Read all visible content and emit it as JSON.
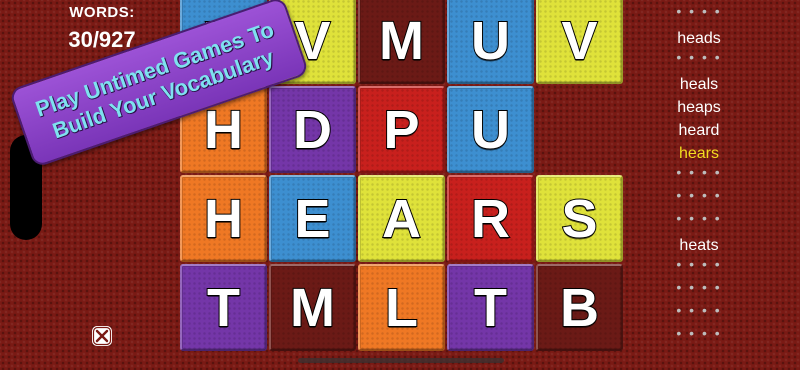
{
  "score": {
    "label": "WORDS:",
    "value": "30/927"
  },
  "board": {
    "tiles": [
      {
        "letter": "V",
        "color": "#3d8fd0"
      },
      {
        "letter": "V",
        "color": "#dfe23a"
      },
      {
        "letter": "M",
        "color": "#6b1a16"
      },
      {
        "letter": "U",
        "color": "#3d8fd0"
      },
      {
        "letter": "V",
        "color": "#dfe23a"
      },
      {
        "letter": "H",
        "color": "#ef7824"
      },
      {
        "letter": "D",
        "color": "#7436a8"
      },
      {
        "letter": "P",
        "color": "#c8201d"
      },
      {
        "letter": "U",
        "color": "#3d8fd0"
      },
      null,
      {
        "letter": "H",
        "color": "#ef7824"
      },
      {
        "letter": "E",
        "color": "#3d8fd0"
      },
      {
        "letter": "A",
        "color": "#dfe23a"
      },
      {
        "letter": "R",
        "color": "#c8201d"
      },
      {
        "letter": "S",
        "color": "#dfe23a"
      },
      {
        "letter": "T",
        "color": "#7436a8"
      },
      {
        "letter": "M",
        "color": "#6b1a16"
      },
      {
        "letter": "L",
        "color": "#ef7824"
      },
      {
        "letter": "T",
        "color": "#7436a8"
      },
      {
        "letter": "B",
        "color": "#6b1a16"
      }
    ]
  },
  "word_list": [
    {
      "text": "• • • •",
      "state": "hidden"
    },
    {
      "text": "heads",
      "state": "found"
    },
    {
      "text": "• • • •",
      "state": "hidden"
    },
    {
      "text": "heals",
      "state": "found"
    },
    {
      "text": "heaps",
      "state": "found"
    },
    {
      "text": "heard",
      "state": "found"
    },
    {
      "text": "hears",
      "state": "highlight"
    },
    {
      "text": "• • • •",
      "state": "hidden"
    },
    {
      "text": "• • • •",
      "state": "hidden"
    },
    {
      "text": "• • • •",
      "state": "hidden"
    },
    {
      "text": "heats",
      "state": "found"
    },
    {
      "text": "• • • •",
      "state": "hidden"
    },
    {
      "text": "• • • •",
      "state": "hidden"
    },
    {
      "text": "• • • •",
      "state": "hidden"
    },
    {
      "text": "• • • •",
      "state": "hidden"
    }
  ],
  "promo": {
    "line1": "Play Untimed Games To",
    "line2": "Build Your Vocabulary"
  },
  "icons": {
    "close": "close-icon",
    "slider": "slider-handle-icon"
  }
}
